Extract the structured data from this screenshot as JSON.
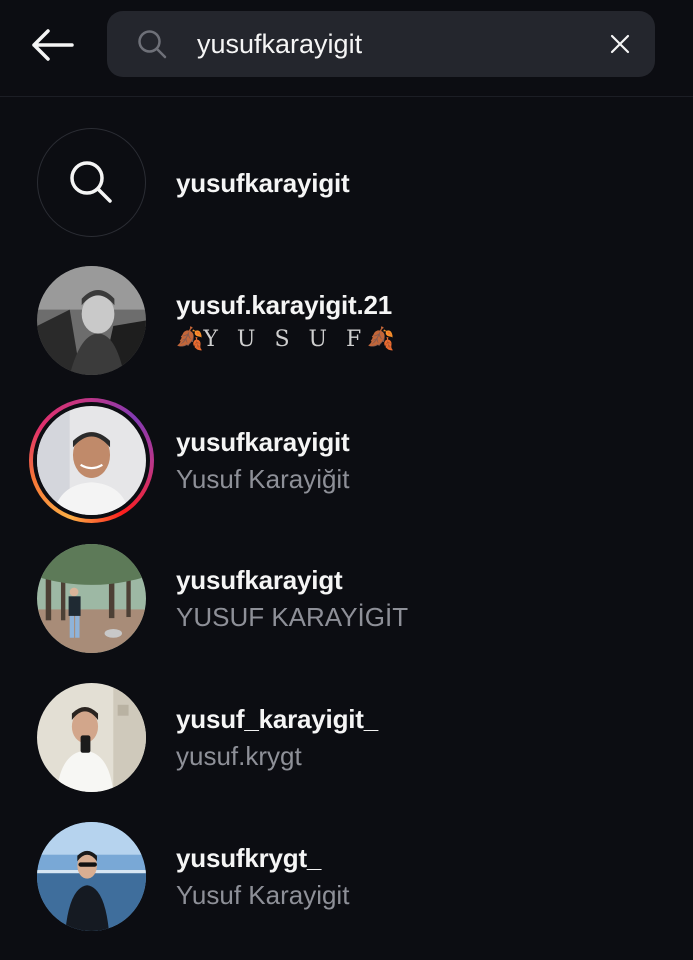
{
  "search": {
    "query": "yusufkarayigit",
    "back_icon": "arrow-left-icon",
    "search_icon": "search-icon",
    "clear_icon": "close-icon"
  },
  "suggestion": {
    "label": "yusufkarayigit",
    "icon": "search-icon"
  },
  "results": [
    {
      "username": "yusuf.karayigit.21",
      "full_name_deco": "Y U S U F",
      "leaf_emoji": "🍂",
      "has_story": false
    },
    {
      "username": "yusufkarayigit",
      "full_name": "Yusuf Karayiğit",
      "has_story": true
    },
    {
      "username": "yusufkarayigt",
      "full_name": "YUSUF KARAYİGİT",
      "has_story": false
    },
    {
      "username": "yusuf_karayigit_",
      "full_name": "yusuf.krygt",
      "has_story": false
    },
    {
      "username": "yusufkrygt_",
      "full_name": "Yusuf Karayigit",
      "has_story": false
    }
  ],
  "colors": {
    "background": "#0c0d12",
    "search_field": "#24262d",
    "secondary_text": "#8e9098",
    "story_ring": [
      "#fcaf45",
      "#e1306c",
      "#833ab4"
    ]
  }
}
